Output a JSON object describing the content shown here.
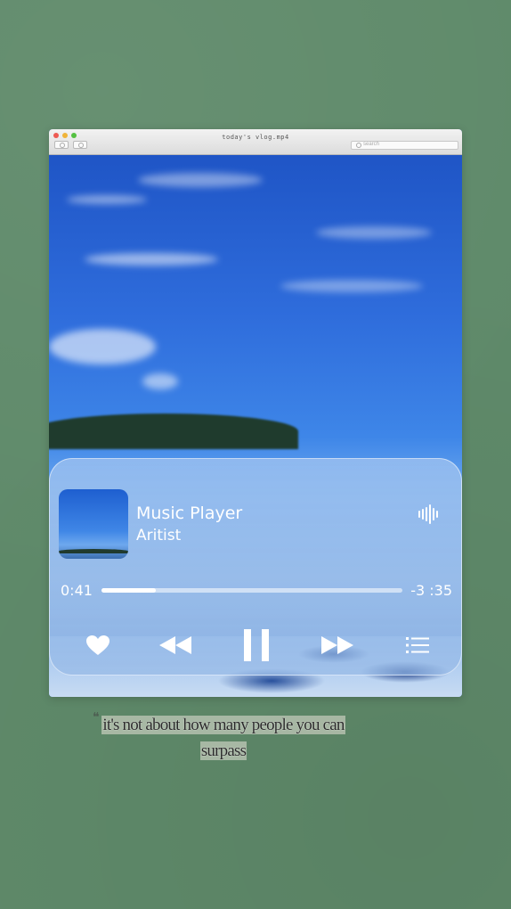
{
  "window": {
    "title": "today's vlog.mp4",
    "search_placeholder": "search"
  },
  "player": {
    "song_title": "Music Player",
    "artist": "Aritist",
    "time_elapsed": "0:41",
    "time_remaining": "-3 :35",
    "progress_fraction": 0.18,
    "icons": {
      "waveform": "waveform-icon",
      "like": "heart-icon",
      "previous": "rewind-icon",
      "play_pause": "pause-icon",
      "next": "fast-forward-icon",
      "queue": "list-icon"
    }
  },
  "caption": {
    "line1": "it's not about how many people you can",
    "line2": "surpass"
  },
  "colors": {
    "background": "#5f8a6a",
    "player_text": "#ffffff",
    "sky": "#2f6ddc"
  }
}
